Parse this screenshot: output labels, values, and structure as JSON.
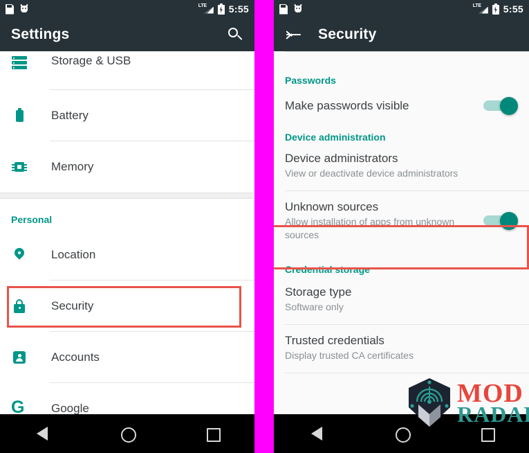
{
  "status_bar": {
    "time": "5:55",
    "icons": [
      "sd-card-icon",
      "android-debug-icon",
      "lte-signal-icon",
      "battery-charging-icon"
    ],
    "network_label": "LTE"
  },
  "colors": {
    "accent_teal": "#009688",
    "app_bar": "#263238",
    "highlight_red": "#e8534a",
    "divider_magenta": "#ff00ff",
    "toggle_on_thumb": "#00897b",
    "toggle_on_track": "#a7d8d2"
  },
  "left_phone": {
    "app_bar": {
      "title": "Settings",
      "search_icon": "search-icon"
    },
    "rows": [
      {
        "label": "Storage & USB",
        "icon": "storage-icon",
        "highlighted": false
      },
      {
        "label": "Battery",
        "icon": "battery-icon",
        "highlighted": false
      },
      {
        "label": "Memory",
        "icon": "memory-icon",
        "highlighted": false
      }
    ],
    "section_header": "Personal",
    "personal_rows": [
      {
        "label": "Location",
        "icon": "location-pin-icon",
        "highlighted": false
      },
      {
        "label": "Security",
        "icon": "lock-icon",
        "highlighted": true
      },
      {
        "label": "Accounts",
        "icon": "account-icon",
        "highlighted": false
      },
      {
        "label": "Google",
        "icon": "google-g-icon",
        "highlighted": false
      }
    ]
  },
  "right_phone": {
    "app_bar": {
      "title": "Security",
      "back_icon": "back-arrow-icon"
    },
    "sections": [
      {
        "header": "Passwords",
        "rows": [
          {
            "title": "Make passwords visible",
            "subtitle": "",
            "toggle": true,
            "toggle_on": true,
            "highlighted": false
          }
        ]
      },
      {
        "header": "Device administration",
        "rows": [
          {
            "title": "Device administrators",
            "subtitle": "View or deactivate device administrators",
            "toggle": false,
            "toggle_on": false,
            "highlighted": false
          },
          {
            "title": "Unknown sources",
            "subtitle": "Allow installation of apps from unknown sources",
            "toggle": true,
            "toggle_on": true,
            "highlighted": true
          }
        ]
      },
      {
        "header": "Credential storage",
        "rows": [
          {
            "title": "Storage type",
            "subtitle": "Software only",
            "toggle": false,
            "toggle_on": false,
            "highlighted": false
          },
          {
            "title": "Trusted credentials",
            "subtitle": "Display trusted CA certificates",
            "toggle": false,
            "toggle_on": false,
            "highlighted": false
          }
        ]
      }
    ]
  },
  "nav_bar": {
    "buttons": [
      {
        "name": "back-nav-button",
        "icon": "triangle-back-icon"
      },
      {
        "name": "home-nav-button",
        "icon": "circle-home-icon"
      },
      {
        "name": "recents-nav-button",
        "icon": "square-recents-icon"
      }
    ]
  },
  "watermark": {
    "line1": "MOD",
    "line2": "RADAR",
    "logo_icon": "mod-radar-logo-icon"
  }
}
